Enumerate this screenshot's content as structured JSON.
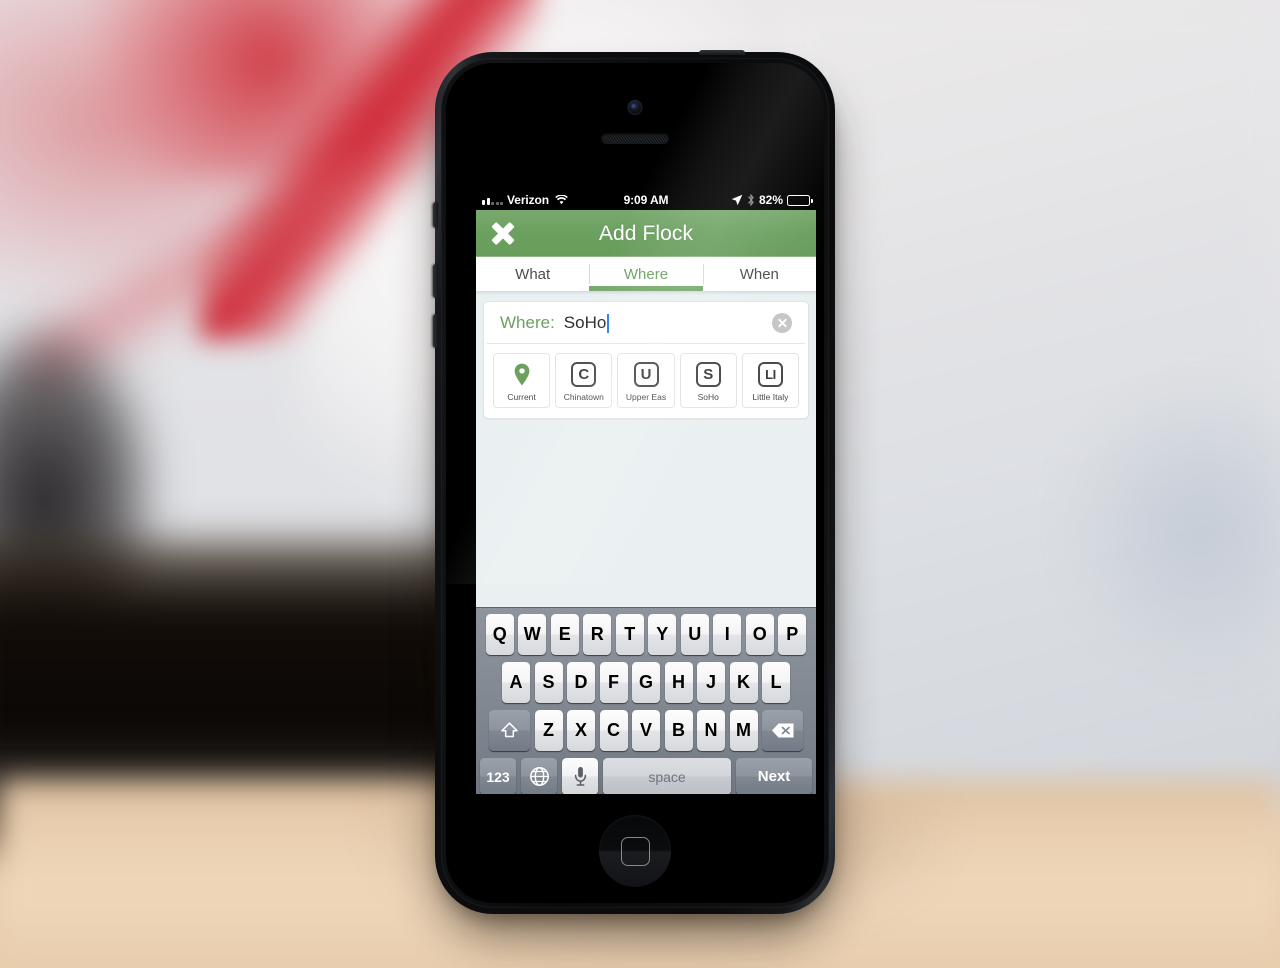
{
  "status_bar": {
    "carrier": "Verizon",
    "time": "9:09 AM",
    "battery_percent": "82%",
    "icons": [
      "signal-bars-icon",
      "wifi-icon",
      "location-arrow-icon",
      "bluetooth-icon",
      "battery-icon"
    ]
  },
  "navbar": {
    "title": "Add Flock",
    "close_label": "×",
    "accent_color": "#6ba05f"
  },
  "tabs": [
    {
      "label": "What",
      "active": false
    },
    {
      "label": "Where",
      "active": true
    },
    {
      "label": "When",
      "active": false
    }
  ],
  "where_field": {
    "label": "Where:",
    "value": "SoHo",
    "placeholder": "Where:",
    "clear_label": "×"
  },
  "location_chips": [
    {
      "glyph": "",
      "label": "Current",
      "type": "pin"
    },
    {
      "glyph": "C",
      "label": "Chinatown",
      "type": "letter"
    },
    {
      "glyph": "U",
      "label": "Upper Eas",
      "type": "letter"
    },
    {
      "glyph": "S",
      "label": "SoHo",
      "type": "letter"
    },
    {
      "glyph": "LI",
      "label": "Little Italy",
      "type": "letter"
    }
  ],
  "keyboard": {
    "row1": [
      "Q",
      "W",
      "E",
      "R",
      "T",
      "Y",
      "U",
      "I",
      "O",
      "P"
    ],
    "row2": [
      "A",
      "S",
      "D",
      "F",
      "G",
      "H",
      "J",
      "K",
      "L"
    ],
    "row3": [
      "Z",
      "X",
      "C",
      "V",
      "B",
      "N",
      "M"
    ],
    "shift_label": "shift-icon",
    "backspace_label": "backspace-icon",
    "numeric_label": "123",
    "globe_label": "globe-icon",
    "mic_label": "microphone-icon",
    "space_label": "space",
    "return_label": "Next"
  }
}
